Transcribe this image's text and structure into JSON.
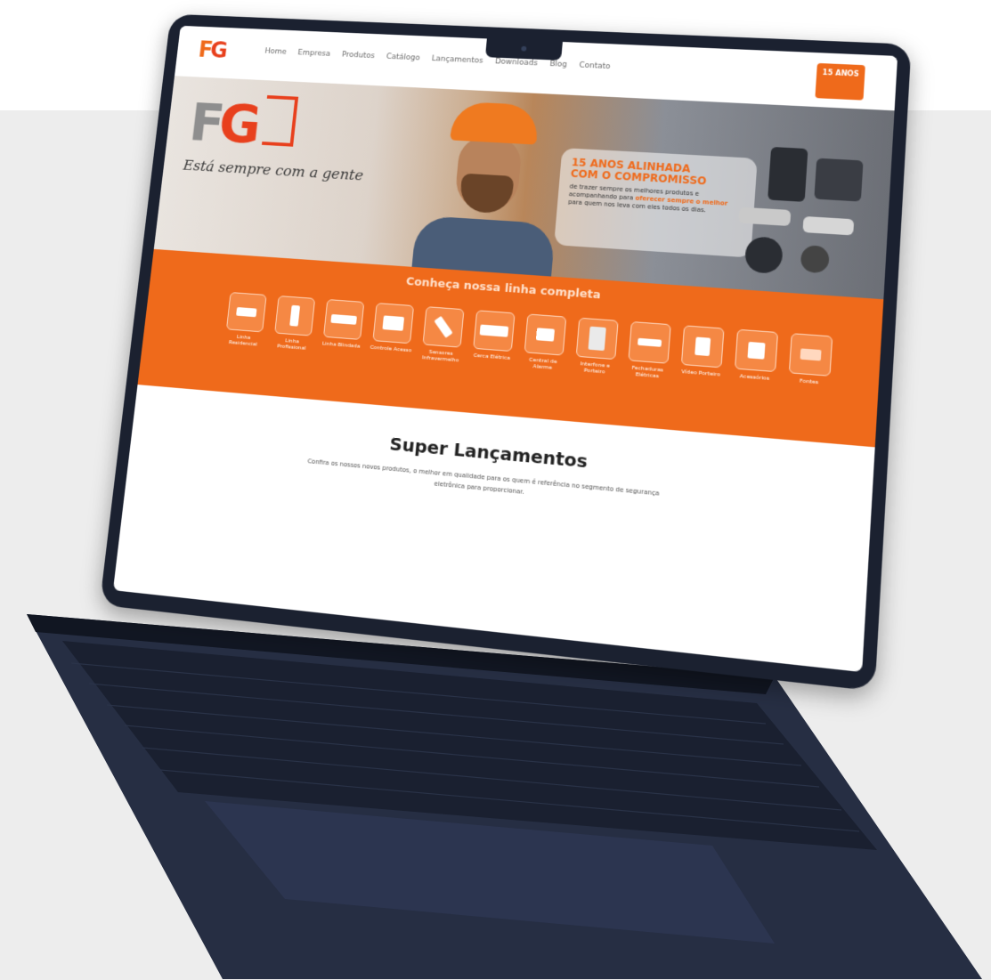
{
  "logo": {
    "text_f": "F",
    "text_g": "G"
  },
  "nav": {
    "items": [
      "Home",
      "Empresa",
      "Produtos",
      "Catálogo",
      "Lançamentos",
      "Downloads",
      "Blog",
      "Contato"
    ]
  },
  "years_badge": "15 ANOS",
  "hero": {
    "logo_f": "F",
    "logo_g": "G",
    "slogan": "Está sempre com a gente",
    "card_title_line1": "15 ANOS ALINHADA",
    "card_title_line2": "COM O COMPROMISSO",
    "card_text_pre": "de trazer sempre os melhores produtos e acompanhando para",
    "card_text_bold": "oferecer sempre o melhor",
    "card_text_post": "para quem nos leva com eles todos os dias."
  },
  "lines": {
    "title": "Conheça nossa linha completa",
    "categories": [
      "Linha Residencial",
      "Linha Profissional",
      "Linha Blindada",
      "Controle Acesso",
      "Sensores Infravermelho",
      "Cerca Elétrica",
      "Central de Alarme",
      "Interfone e Porteiro",
      "Fechaduras Elétricas",
      "Vídeo Porteiro",
      "Acessórios",
      "Fontes"
    ]
  },
  "launches": {
    "title": "Super Lançamentos",
    "description": "Confira os nossos novos produtos, o melhor em qualidade para os quem é referência no segmento de segurança eletrônica para proporcionar."
  },
  "colors": {
    "brand_orange": "#ef6a1b",
    "brand_red": "#e8401d",
    "laptop_body": "#1b2130",
    "page_bg": "#ededed"
  }
}
